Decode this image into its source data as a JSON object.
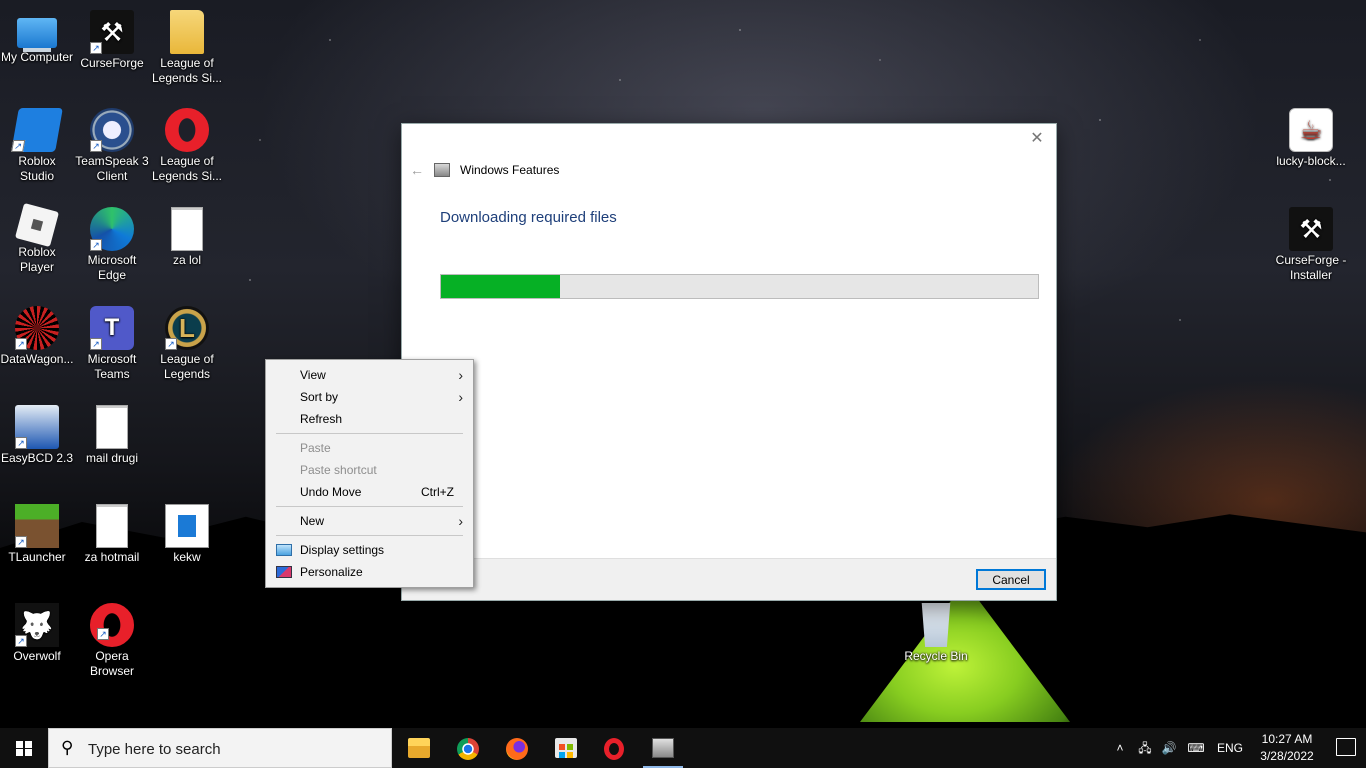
{
  "desktop": {
    "icons": [
      {
        "label": "My Computer",
        "icon": "computer-icon"
      },
      {
        "label": "CurseForge",
        "icon": "anvil-icon"
      },
      {
        "label": "League of Legends Si...",
        "icon": "folder-icon"
      },
      {
        "label": "Roblox Studio",
        "icon": "roblox-studio-icon"
      },
      {
        "label": "TeamSpeak 3 Client",
        "icon": "teamspeak-icon"
      },
      {
        "label": "League of Legends Si...",
        "icon": "opera-icon"
      },
      {
        "label": "Roblox Player",
        "icon": "roblox-player-icon"
      },
      {
        "label": "Microsoft Edge",
        "icon": "edge-icon"
      },
      {
        "label": "za lol",
        "icon": "text-document-icon"
      },
      {
        "label": "DataWagon...",
        "icon": "datawagon-icon"
      },
      {
        "label": "Microsoft Teams",
        "icon": "teams-icon"
      },
      {
        "label": "League of Legends",
        "icon": "league-of-legends-icon"
      },
      {
        "label": "EasyBCD 2.3",
        "icon": "easybcd-icon"
      },
      {
        "label": "mail drugi",
        "icon": "text-document-icon"
      },
      {
        "label": "TLauncher",
        "icon": "tlauncher-icon"
      },
      {
        "label": "za hotmail",
        "icon": "text-document-icon"
      },
      {
        "label": "kekw",
        "icon": "image-document-icon"
      },
      {
        "label": "Overwolf",
        "icon": "overwolf-icon"
      },
      {
        "label": "Opera Browser",
        "icon": "opera-icon"
      },
      {
        "label": "lucky-block...",
        "icon": "java-icon"
      },
      {
        "label": "CurseForge - Installer",
        "icon": "anvil-icon"
      },
      {
        "label": "Recycle Bin",
        "icon": "recycle-bin-icon"
      }
    ]
  },
  "dialog": {
    "title": "Windows Features",
    "heading": "Downloading required files",
    "progress": 0.2,
    "cancel_label": "Cancel",
    "close_glyph": "✕",
    "back_glyph": "←",
    "progress_color": "#06b025"
  },
  "context_menu": {
    "items": [
      {
        "label": "View",
        "submenu": true
      },
      {
        "label": "Sort by",
        "submenu": true
      },
      {
        "label": "Refresh"
      },
      {
        "label": "Paste",
        "disabled": true
      },
      {
        "label": "Paste shortcut",
        "disabled": true
      },
      {
        "label": "Undo Move",
        "shortcut": "Ctrl+Z"
      },
      {
        "label": "New",
        "submenu": true
      },
      {
        "label": "Display settings",
        "icon": "display-settings-icon"
      },
      {
        "label": "Personalize",
        "icon": "personalize-icon"
      }
    ],
    "submenu_glyph": "›"
  },
  "taskbar": {
    "search_placeholder": "Type here to search",
    "apps": [
      {
        "name": "File Explorer",
        "icon": "file-explorer-icon"
      },
      {
        "name": "Google Chrome",
        "icon": "chrome-icon"
      },
      {
        "name": "Firefox",
        "icon": "firefox-icon"
      },
      {
        "name": "Microsoft Store",
        "icon": "store-icon"
      },
      {
        "name": "Opera",
        "icon": "opera-icon"
      },
      {
        "name": "Windows Features",
        "icon": "windows-features-icon"
      }
    ],
    "tray": {
      "language": "ENG",
      "time": "10:27 AM",
      "date": "3/28/2022"
    }
  }
}
